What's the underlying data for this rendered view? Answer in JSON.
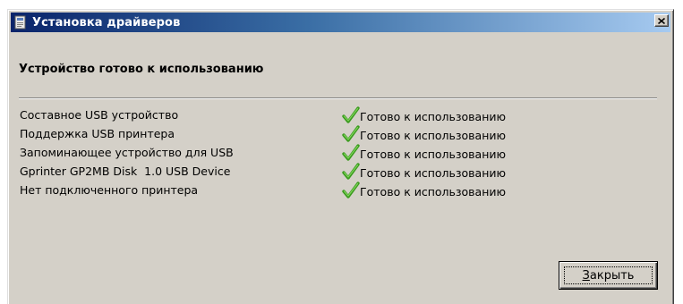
{
  "window": {
    "title": "Установка драйверов",
    "title_icon": "setup-icon",
    "close_icon": "close-x-icon"
  },
  "heading": "Устройство готово к использованию",
  "devices": [
    {
      "name": "Составное USB устройство",
      "status": "Готово к использованию",
      "status_icon": "green-check-icon"
    },
    {
      "name": "Поддержка USB принтера",
      "status": "Готово к использованию",
      "status_icon": "green-check-icon"
    },
    {
      "name": "Запоминающее устройство для USB",
      "status": "Готово к использованию",
      "status_icon": "green-check-icon"
    },
    {
      "name": "Gprinter GP2MB Disk  1.0 USB Device",
      "status": "Готово к использованию",
      "status_icon": "green-check-icon"
    },
    {
      "name": "Нет подключенного принтера",
      "status": "Готово к использованию",
      "status_icon": "green-check-icon"
    }
  ],
  "buttons": {
    "close_label": "Закрыть",
    "close_accel": "З",
    "close_rest": "акрыть"
  },
  "colors": {
    "titlebar_start": "#0a246a",
    "titlebar_end": "#a6caf0",
    "window_face": "#d4d0c8",
    "check_green": "#4caf2a"
  }
}
